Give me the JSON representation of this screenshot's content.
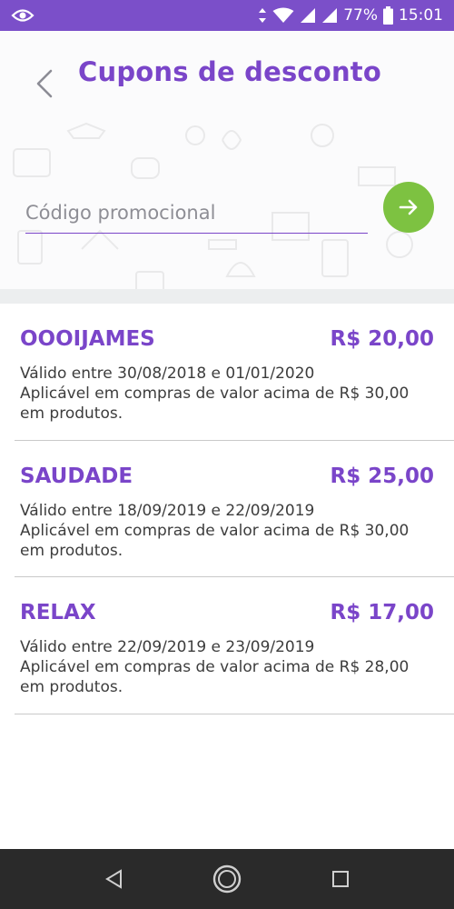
{
  "status_bar": {
    "battery": "77%",
    "time": "15:01"
  },
  "header": {
    "title": "Cupons de desconto"
  },
  "promo": {
    "placeholder": "Código promocional"
  },
  "coupons": [
    {
      "code": "OOOIJAMES",
      "value": "R$ 20,00",
      "validity": "Válido entre 30/08/2018 e 01/01/2020",
      "condition": "Aplicável em compras de valor acima de R$ 30,00 em produtos."
    },
    {
      "code": "SAUDADE",
      "value": "R$ 25,00",
      "validity": "Válido entre 18/09/2019 e 22/09/2019",
      "condition": "Aplicável em compras de valor acima de R$ 30,00 em produtos."
    },
    {
      "code": "RELAX",
      "value": "R$ 17,00",
      "validity": "Válido entre 22/09/2019 e 23/09/2019",
      "condition": "Aplicável em compras de valor acima de R$ 28,00 em produtos."
    }
  ],
  "colors": {
    "brand_purple": "#7a45c9",
    "status_bar": "#7b4fc9",
    "go_button": "#7dc241"
  }
}
